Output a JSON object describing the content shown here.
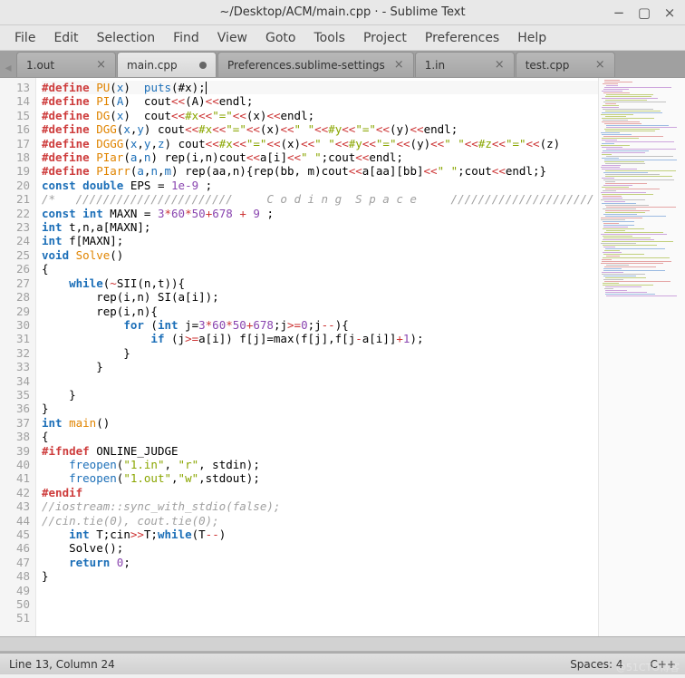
{
  "window": {
    "title": "~/Desktop/ACM/main.cpp  ·  - Sublime Text"
  },
  "menu": [
    "File",
    "Edit",
    "Selection",
    "Find",
    "View",
    "Goto",
    "Tools",
    "Project",
    "Preferences",
    "Help"
  ],
  "tabs": [
    {
      "label": "1.out",
      "dirty": false,
      "active": false
    },
    {
      "label": "main.cpp",
      "dirty": true,
      "active": true
    },
    {
      "label": "Preferences.sublime-settings",
      "dirty": false,
      "active": false
    },
    {
      "label": "1.in",
      "dirty": false,
      "active": false
    },
    {
      "label": "test.cpp",
      "dirty": false,
      "active": false
    }
  ],
  "editor": {
    "first_line": 13,
    "last_line": 51,
    "caret_line": 13
  },
  "code_lines": [
    {
      "n": 13,
      "html": "<span class='k-red'>#define</span> <span class='k-orange'>PU</span>(<span class='k-blue'>x</span>)  <span class='k-blue'>puts</span>(#x);<span class='caret'></span>"
    },
    {
      "n": 14,
      "html": "<span class='k-red'>#define</span> <span class='k-orange'>PI</span>(<span class='k-blue'>A</span>)  cout<span class='k-op'>&lt;&lt;</span>(A)<span class='k-op'>&lt;&lt;</span>endl;"
    },
    {
      "n": 15,
      "html": "<span class='k-red'>#define</span> <span class='k-orange'>DG</span>(<span class='k-blue'>x</span>)  cout<span class='k-op'>&lt;&lt;</span><span class='k-str'>#x</span><span class='k-op'>&lt;&lt;</span><span class='k-str'>\"=\"</span><span class='k-op'>&lt;&lt;</span>(x)<span class='k-op'>&lt;&lt;</span>endl;"
    },
    {
      "n": 16,
      "html": "<span class='k-red'>#define</span> <span class='k-orange'>DGG</span>(<span class='k-blue'>x</span>,<span class='k-blue'>y</span>) cout<span class='k-op'>&lt;&lt;</span><span class='k-str'>#x</span><span class='k-op'>&lt;&lt;</span><span class='k-str'>\"=\"</span><span class='k-op'>&lt;&lt;</span>(x)<span class='k-op'>&lt;&lt;</span><span class='k-str'>\" \"</span><span class='k-op'>&lt;&lt;</span><span class='k-str'>#y</span><span class='k-op'>&lt;&lt;</span><span class='k-str'>\"=\"</span><span class='k-op'>&lt;&lt;</span>(y)<span class='k-op'>&lt;&lt;</span>endl;"
    },
    {
      "n": 17,
      "html": "<span class='k-red'>#define</span> <span class='k-orange'>DGGG</span>(<span class='k-blue'>x</span>,<span class='k-blue'>y</span>,<span class='k-blue'>z</span>) cout<span class='k-op'>&lt;&lt;</span><span class='k-str'>#x</span><span class='k-op'>&lt;&lt;</span><span class='k-str'>\"=\"</span><span class='k-op'>&lt;&lt;</span>(x)<span class='k-op'>&lt;&lt;</span><span class='k-str'>\" \"</span><span class='k-op'>&lt;&lt;</span><span class='k-str'>#y</span><span class='k-op'>&lt;&lt;</span><span class='k-str'>\"=\"</span><span class='k-op'>&lt;&lt;</span>(y)<span class='k-op'>&lt;&lt;</span><span class='k-str'>\" \"</span><span class='k-op'>&lt;&lt;</span><span class='k-str'>#z</span><span class='k-op'>&lt;&lt;</span><span class='k-str'>\"=\"</span><span class='k-op'>&lt;&lt;</span>(z)<span class='k-op'></span>"
    },
    {
      "n": 18,
      "html": "<span class='k-red'>#define</span> <span class='k-orange'>PIar</span>(<span class='k-blue'>a</span>,<span class='k-blue'>n</span>) rep(i,n)cout<span class='k-op'>&lt;&lt;</span>a[i]<span class='k-op'>&lt;&lt;</span><span class='k-str'>\" \"</span>;cout<span class='k-op'>&lt;&lt;</span>endl;"
    },
    {
      "n": 19,
      "html": "<span class='k-red'>#define</span> <span class='k-orange'>PIarr</span>(<span class='k-blue'>a</span>,<span class='k-blue'>n</span>,<span class='k-blue'>m</span>) rep(aa,n){rep(bb, m)cout<span class='k-op'>&lt;&lt;</span>a[aa][bb]<span class='k-op'>&lt;&lt;</span><span class='k-str'>\" \"</span>;cout<span class='k-op'>&lt;&lt;</span>endl;}"
    },
    {
      "n": 20,
      "html": "<span class='k-type'>const</span> <span class='k-type'>double</span> EPS = <span class='k-num'>1e-9</span> ;"
    },
    {
      "n": 21,
      "html": "<span class='k-comment'>/*   ///////////////////////     C o d i n g  S p a c e     /////////////////////</span>"
    },
    {
      "n": 22,
      "html": "<span class='k-type'>const</span> <span class='k-type'>int</span> MAXN = <span class='k-num'>3</span><span class='k-op'>*</span><span class='k-num'>60</span><span class='k-op'>*</span><span class='k-num'>50</span><span class='k-op'>+</span><span class='k-num'>678</span> <span class='k-op'>+</span> <span class='k-num'>9</span> ;"
    },
    {
      "n": 23,
      "html": "<span class='k-type'>int</span> t,n,a[MAXN];"
    },
    {
      "n": 24,
      "html": "<span class='k-type'>int</span> f[MAXN];"
    },
    {
      "n": 25,
      "html": "<span class='k-type'>void</span> <span class='k-orange'>Solve</span>()"
    },
    {
      "n": 26,
      "html": "{"
    },
    {
      "n": 27,
      "html": "    <span class='k-type'>while</span>(<span class='k-op'>~</span>SII(n,t)){"
    },
    {
      "n": 28,
      "html": "        rep(i,n) SI(a[i]);"
    },
    {
      "n": 29,
      "html": "        rep(i,n){"
    },
    {
      "n": 30,
      "html": "            <span class='k-type'>for</span> (<span class='k-type'>int</span> j=<span class='k-num'>3</span><span class='k-op'>*</span><span class='k-num'>60</span><span class='k-op'>*</span><span class='k-num'>50</span><span class='k-op'>+</span><span class='k-num'>678</span>;j<span class='k-op'>&gt;=</span><span class='k-num'>0</span>;j<span class='k-op'>--</span>){"
    },
    {
      "n": 31,
      "html": "                <span class='k-type'>if</span> (j<span class='k-op'>&gt;=</span>a[i]) f[j]=max(f[j],f[j<span class='k-op'>-</span>a[i]]<span class='k-op'>+</span><span class='k-num'>1</span>);"
    },
    {
      "n": 32,
      "html": "            }"
    },
    {
      "n": 33,
      "html": "        }"
    },
    {
      "n": 34,
      "html": ""
    },
    {
      "n": 35,
      "html": "    }"
    },
    {
      "n": 36,
      "html": "}"
    },
    {
      "n": 37,
      "html": "<span class='k-type'>int</span> <span class='k-orange'>main</span>()"
    },
    {
      "n": 38,
      "html": "{"
    },
    {
      "n": 39,
      "html": "<span class='k-red'>#ifndef</span> ONLINE_JUDGE"
    },
    {
      "n": 40,
      "html": "    <span class='k-blue'>freopen</span>(<span class='k-str'>\"1.in\"</span>, <span class='k-str'>\"r\"</span>, stdin);"
    },
    {
      "n": 41,
      "html": "    <span class='k-blue'>freopen</span>(<span class='k-str'>\"1.out\"</span>,<span class='k-str'>\"w\"</span>,stdout);"
    },
    {
      "n": 42,
      "html": "<span class='k-red'>#endif</span>"
    },
    {
      "n": 43,
      "html": "<span class='k-comment'>//iostream::sync_with_stdio(false);</span>"
    },
    {
      "n": 44,
      "html": "<span class='k-comment'>//cin.tie(0), cout.tie(0);</span>"
    },
    {
      "n": 45,
      "html": "    <span class='k-type'>int</span> T;cin<span class='k-op'>&gt;&gt;</span>T;<span class='k-type'>while</span>(T<span class='k-op'>--</span>)"
    },
    {
      "n": 46,
      "html": "    Solve();"
    },
    {
      "n": 47,
      "html": "    <span class='k-type'>return</span> <span class='k-num'>0</span>;"
    },
    {
      "n": 48,
      "html": "}"
    },
    {
      "n": 49,
      "html": ""
    },
    {
      "n": 50,
      "html": ""
    },
    {
      "n": 51,
      "html": ""
    }
  ],
  "status": {
    "left": "Line 13, Column 24",
    "spaces": "Spaces: 4",
    "lang": "C++"
  },
  "watermark": "@51CTO博客"
}
